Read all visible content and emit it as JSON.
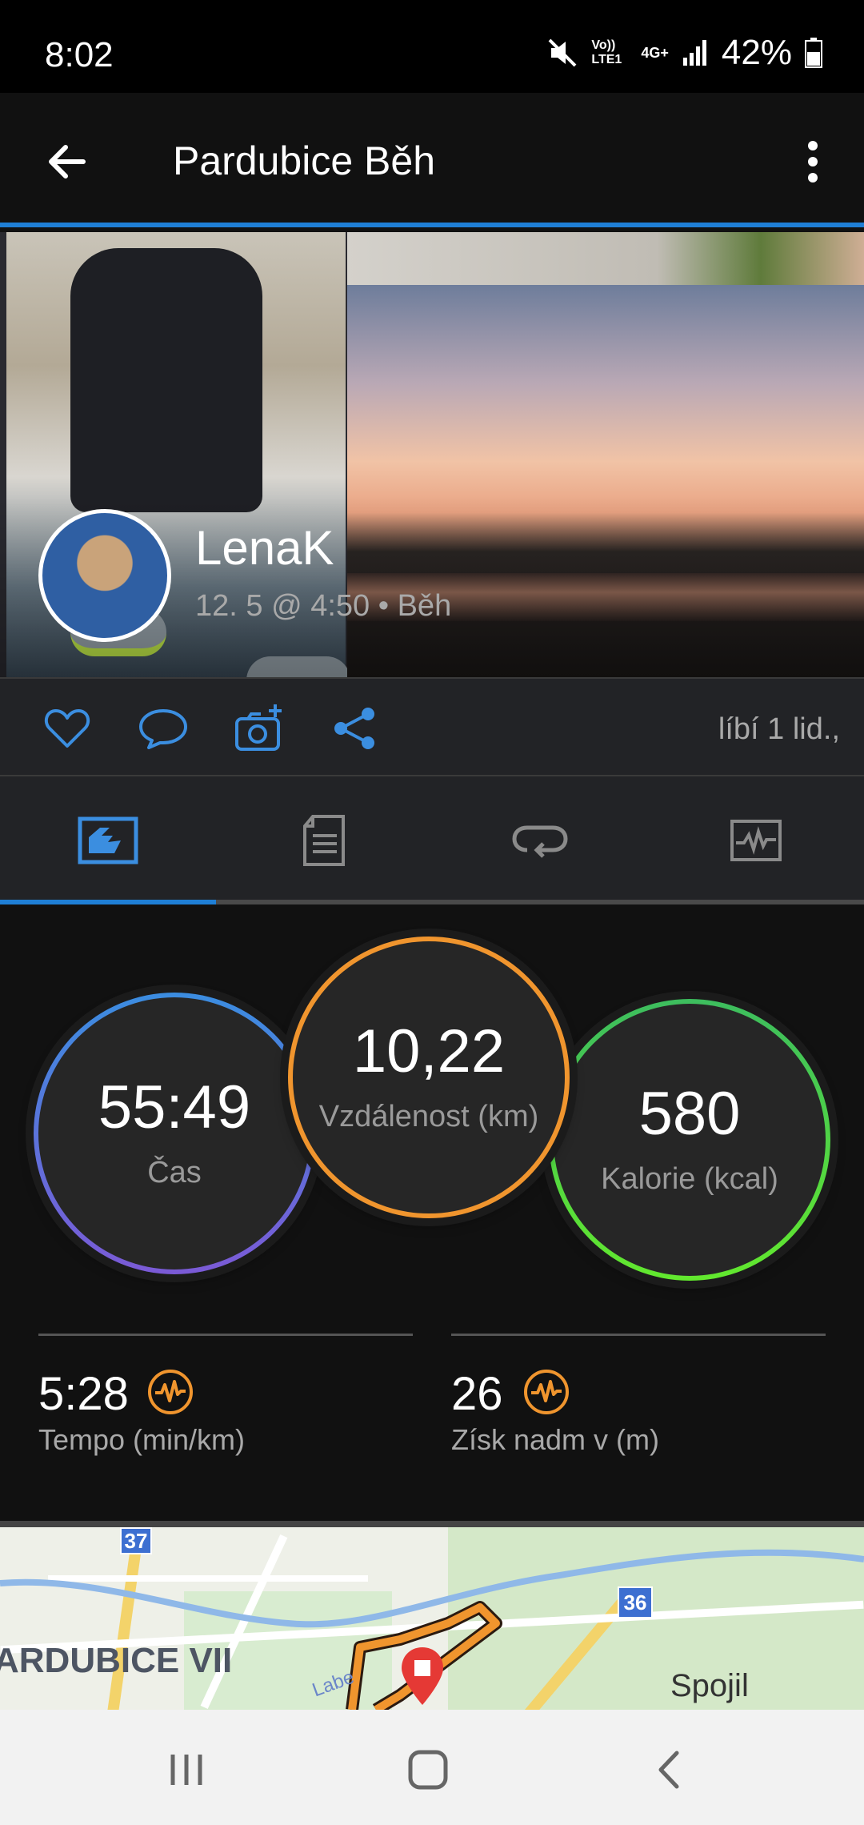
{
  "status_bar": {
    "time": "8:02",
    "network_volte": "Vo)) LTE1",
    "network_type": "4G+",
    "battery": "42%"
  },
  "app_bar": {
    "title": "Pardubice Běh",
    "back_icon": "arrow-left-icon",
    "menu_icon": "more-vert-icon"
  },
  "post": {
    "user_name": "LenaK",
    "meta": "12. 5 @ 4:50 • Běh",
    "likes_text": "líbí 1 lid.,"
  },
  "actions": [
    {
      "name": "like",
      "icon": "heart-icon"
    },
    {
      "name": "comment",
      "icon": "comment-icon"
    },
    {
      "name": "add-photo",
      "icon": "camera-plus-icon"
    },
    {
      "name": "share",
      "icon": "share-icon"
    }
  ],
  "tabs": [
    {
      "name": "overview",
      "icon": "overview-icon",
      "active": true
    },
    {
      "name": "details",
      "icon": "document-icon",
      "active": false
    },
    {
      "name": "laps",
      "icon": "repeat-icon",
      "active": false
    },
    {
      "name": "charts",
      "icon": "chart-icon",
      "active": false
    }
  ],
  "stats": {
    "time": {
      "value": "55:49",
      "label": "Čas"
    },
    "distance": {
      "value": "10,22",
      "label": "Vzdálenost (km)"
    },
    "calories": {
      "value": "580",
      "label": "Kalorie (kcal)"
    },
    "pace": {
      "value": "5:28",
      "label": "Tempo (min/km)"
    },
    "elevation": {
      "value": "26",
      "label": "Získ nadm v (m)"
    }
  },
  "map": {
    "label_left": "ARDUBICE VII",
    "label_right": "Spojil",
    "river_label": "Labe",
    "shield_1": "37",
    "shield_2": "36"
  },
  "colors": {
    "accent_blue": "#1f7fd6",
    "orange": "#f0952e",
    "green": "#3dbd5e"
  }
}
